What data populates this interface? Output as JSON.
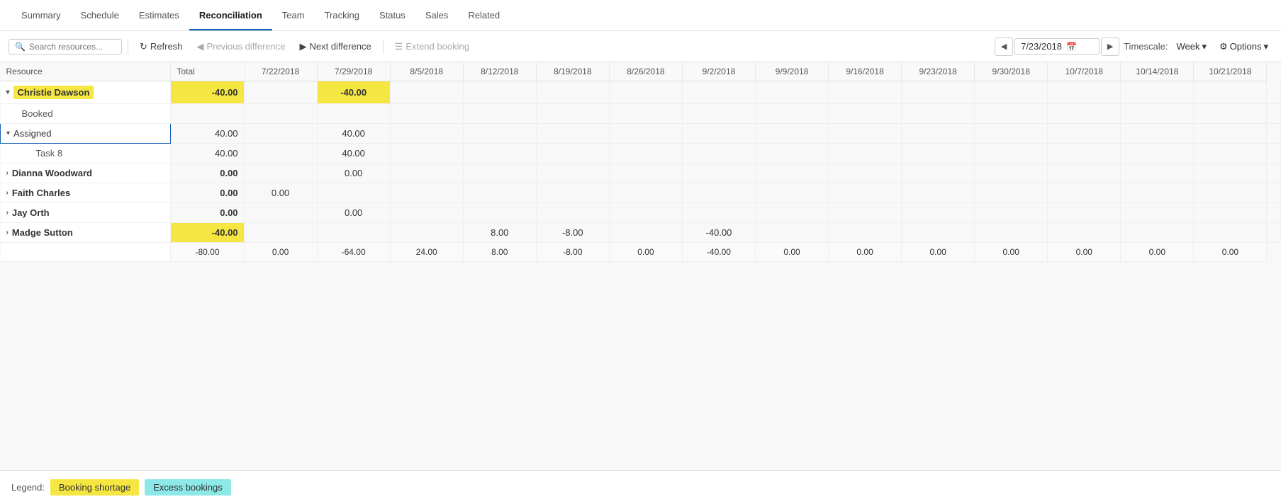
{
  "nav": {
    "tabs": [
      {
        "id": "summary",
        "label": "Summary",
        "active": false
      },
      {
        "id": "schedule",
        "label": "Schedule",
        "active": false
      },
      {
        "id": "estimates",
        "label": "Estimates",
        "active": false
      },
      {
        "id": "reconciliation",
        "label": "Reconciliation",
        "active": true
      },
      {
        "id": "team",
        "label": "Team",
        "active": false
      },
      {
        "id": "tracking",
        "label": "Tracking",
        "active": false
      },
      {
        "id": "status",
        "label": "Status",
        "active": false
      },
      {
        "id": "sales",
        "label": "Sales",
        "active": false
      },
      {
        "id": "related",
        "label": "Related",
        "active": false
      }
    ]
  },
  "toolbar": {
    "search_placeholder": "Search resources...",
    "refresh_label": "Refresh",
    "prev_diff_label": "Previous difference",
    "next_diff_label": "Next difference",
    "extend_booking_label": "Extend booking",
    "current_date": "7/23/2018",
    "timescale_label": "Timescale:",
    "timescale_value": "Week",
    "options_label": "Options"
  },
  "grid": {
    "columns": [
      "Resource",
      "Total",
      "7/22/2018",
      "7/29/2018",
      "8/5/2018",
      "8/12/2018",
      "8/19/2018",
      "8/26/2018",
      "9/2/2018",
      "9/9/2018",
      "9/16/2018",
      "9/23/2018",
      "9/30/2018",
      "10/7/2018",
      "10/14/2018",
      "10/21/2018"
    ],
    "rows": [
      {
        "type": "resource",
        "name": "Christie Dawson",
        "expanded": true,
        "highlight": true,
        "values": {
          "total": "-40.00",
          "cols": [
            "",
            "-40.00",
            "",
            "",
            "",
            "",
            "",
            "",
            "",
            "",
            "",
            "",
            "",
            "",
            ""
          ]
        }
      },
      {
        "type": "sub",
        "name": "Booked",
        "values": {
          "total": "",
          "cols": [
            "",
            "",
            "",
            "",
            "",
            "",
            "",
            "",
            "",
            "",
            "",
            "",
            "",
            "",
            ""
          ]
        }
      },
      {
        "type": "assigned",
        "name": "Assigned",
        "expanded": true,
        "values": {
          "total": "40.00",
          "cols": [
            "",
            "40.00",
            "",
            "",
            "",
            "",
            "",
            "",
            "",
            "",
            "",
            "",
            "",
            "",
            ""
          ]
        }
      },
      {
        "type": "task",
        "name": "Task 8",
        "values": {
          "total": "40.00",
          "cols": [
            "",
            "40.00",
            "",
            "",
            "",
            "",
            "",
            "",
            "",
            "",
            "",
            "",
            "",
            "",
            ""
          ]
        }
      },
      {
        "type": "resource",
        "name": "Dianna Woodward",
        "expanded": false,
        "highlight": false,
        "values": {
          "total": "0.00",
          "cols": [
            "",
            "0.00",
            "",
            "",
            "",
            "",
            "",
            "",
            "",
            "",
            "",
            "",
            "",
            "",
            ""
          ]
        }
      },
      {
        "type": "resource",
        "name": "Faith Charles",
        "expanded": false,
        "highlight": false,
        "values": {
          "total": "0.00",
          "cols": [
            "0.00",
            "",
            "",
            "",
            "",
            "",
            "",
            "",
            "",
            "",
            "",
            "",
            "",
            "",
            ""
          ]
        }
      },
      {
        "type": "resource",
        "name": "Jay Orth",
        "expanded": false,
        "highlight": false,
        "values": {
          "total": "0.00",
          "cols": [
            "",
            "0.00",
            "",
            "",
            "",
            "",
            "",
            "",
            "",
            "",
            "",
            "",
            "",
            "",
            ""
          ]
        }
      },
      {
        "type": "resource",
        "name": "Madge Sutton",
        "expanded": false,
        "highlight": false,
        "values": {
          "total": "-40.00",
          "cols": [
            "",
            "",
            "",
            "8.00",
            "-8.00",
            "",
            "-40.00",
            "",
            "",
            "",
            "",
            "",
            "",
            "",
            ""
          ]
        }
      }
    ],
    "totals": [
      "-80.00",
      "0.00",
      "-64.00",
      "24.00",
      "8.00",
      "-8.00",
      "0.00",
      "-40.00",
      "0.00",
      "0.00",
      "0.00",
      "0.00",
      "0.00",
      "0.00",
      "0.00"
    ]
  },
  "legend": {
    "label": "Legend:",
    "shortage_label": "Booking shortage",
    "excess_label": "Excess bookings"
  },
  "icons": {
    "search": "🔍",
    "refresh": "↻",
    "prev": "◀",
    "next": "▶",
    "calendar": "📅",
    "chevron_down": "▾",
    "chevron_right": "›",
    "gear": "⚙"
  }
}
